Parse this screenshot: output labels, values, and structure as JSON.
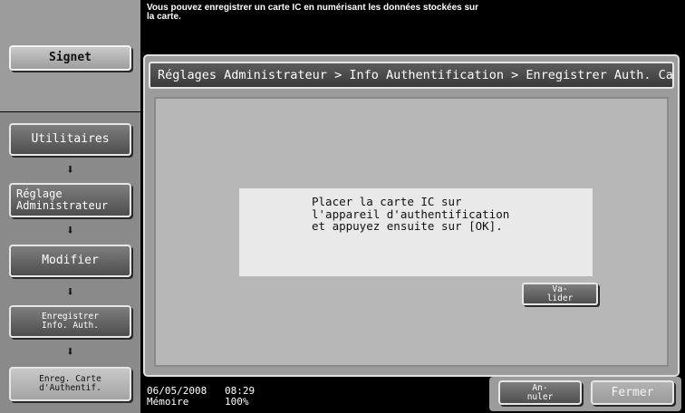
{
  "header": {
    "message": "Vous pouvez enregistrer un carte IC en numérisant les données stockées sur\nla carte."
  },
  "sidebar": {
    "bookmark_label": "Signet",
    "steps": [
      {
        "label": "Utilitaires"
      },
      {
        "label": "Réglage\nAdministrateur"
      },
      {
        "label": "Modifier"
      },
      {
        "label": "Enregistrer\nInfo. Auth."
      },
      {
        "label": "Enreg. Carte\nd'Authentif."
      }
    ],
    "arrow": "⬇"
  },
  "main": {
    "breadcrumb": "Réglages Administrateur > Info Authentification > Enregistrer Auth. Carte",
    "instruction": "Placer la carte IC sur\nl'appareil d'authentification\net appuyez ensuite sur [OK].",
    "valider_label": "Va-\nlider"
  },
  "footer": {
    "date": "06/05/2008",
    "time": "08:29",
    "memory_label": "Mémoire",
    "memory_value": "100%",
    "annuler_label": "An-\nnuler",
    "fermer_label": "Fermer"
  }
}
